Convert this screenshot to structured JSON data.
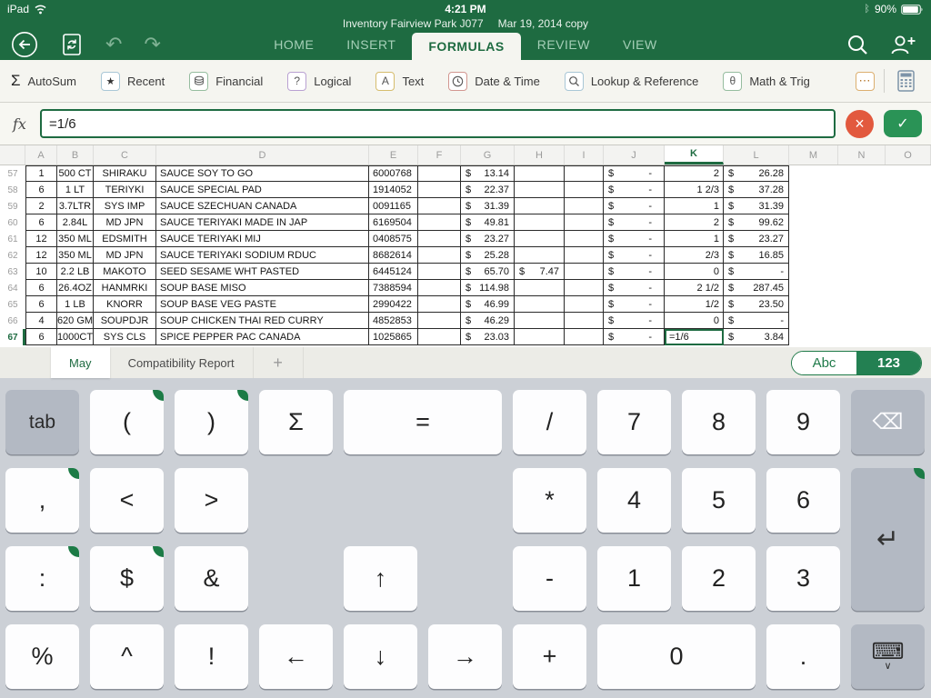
{
  "status_bar": {
    "device": "iPad",
    "time": "4:21 PM",
    "bluetooth_glyph": "ᛒ",
    "battery_pct": "90%"
  },
  "doc_title": {
    "line1": "Inventory Fairview Park  J077",
    "line2": "Mar 19, 2014 copy"
  },
  "nav": {
    "undo_glyph": "↶",
    "redo_glyph": "↷",
    "tabs": [
      {
        "label": "HOME"
      },
      {
        "label": "INSERT"
      },
      {
        "label": "FORMULAS",
        "active": true
      },
      {
        "label": "REVIEW"
      },
      {
        "label": "VIEW"
      }
    ]
  },
  "ribbon": {
    "sigma_glyph": "Σ",
    "items": [
      {
        "label": "AutoSum"
      },
      {
        "label": "Recent"
      },
      {
        "label": "Financial"
      },
      {
        "label": "Logical"
      },
      {
        "label": "Text"
      },
      {
        "label": "Date & Time"
      },
      {
        "label": "Lookup & Reference"
      },
      {
        "label": "Math & Trig"
      }
    ],
    "icon_glyphs": {
      "star": "★",
      "question": "?",
      "letter_a": "A",
      "theta": "θ",
      "more": "⋯"
    }
  },
  "formula_bar": {
    "fx_label": "fx",
    "value": "=1/6",
    "cancel_glyph": "×",
    "confirm_glyph": "✓"
  },
  "grid": {
    "col_headers": [
      "A",
      "B",
      "C",
      "D",
      "E",
      "F",
      "G",
      "H",
      "I",
      "J",
      "K",
      "L",
      "M",
      "N",
      "O"
    ],
    "selected_column": "K",
    "selected_cell": "K67",
    "rows": [
      {
        "n": "57",
        "a": "1",
        "b": "500 CT",
        "c": "SHIRAKU",
        "d": "SAUCE SOY TO GO",
        "e": "6000768",
        "g1": "$",
        "g": "13.14",
        "j1": "$",
        "j": "-",
        "k": "2",
        "l1": "$",
        "l": "26.28"
      },
      {
        "n": "58",
        "a": "6",
        "b": "1 LT",
        "c": "TERIYKI",
        "d": "SAUCE SPECIAL PAD",
        "e": "1914052",
        "g1": "$",
        "g": "22.37",
        "j1": "$",
        "j": "-",
        "k": "1 2/3",
        "l1": "$",
        "l": "37.28"
      },
      {
        "n": "59",
        "a": "2",
        "b": "3.7LTR",
        "c": "SYS IMP",
        "d": "SAUCE SZECHUAN CANADA",
        "e": "0091165",
        "g1": "$",
        "g": "31.39",
        "j1": "$",
        "j": "-",
        "k": "1",
        "l1": "$",
        "l": "31.39"
      },
      {
        "n": "60",
        "a": "6",
        "b": "2.84L",
        "c": "MD JPN",
        "d": "SAUCE TERIYAKI MADE IN JAP",
        "e": "6169504",
        "g1": "$",
        "g": "49.81",
        "j1": "$",
        "j": "-",
        "k": "2",
        "l1": "$",
        "l": "99.62"
      },
      {
        "n": "61",
        "a": "12",
        "b": "350 ML",
        "c": "EDSMITH",
        "d": "SAUCE TERIYAKI MIJ",
        "e": "0408575",
        "g1": "$",
        "g": "23.27",
        "j1": "$",
        "j": "-",
        "k": "1",
        "l1": "$",
        "l": "23.27"
      },
      {
        "n": "62",
        "a": "12",
        "b": "350 ML",
        "c": "MD JPN",
        "d": "SAUCE TERIYAKI SODIUM RDUC",
        "e": "8682614",
        "g1": "$",
        "g": "25.28",
        "j1": "$",
        "j": "-",
        "k": "2/3",
        "l1": "$",
        "l": "16.85"
      },
      {
        "n": "63",
        "a": "10",
        "b": "2.2 LB",
        "c": "MAKOTO",
        "d": "SEED SESAME WHT PASTED",
        "e": "6445124",
        "g1": "$",
        "g": "65.70",
        "h1": "$",
        "h": "7.47",
        "j1": "$",
        "j": "-",
        "k": "0",
        "l1": "$",
        "l": "-"
      },
      {
        "n": "64",
        "a": "6",
        "b": "26.4OZ",
        "c": "HANMRKI",
        "d": "SOUP BASE MISO",
        "e": "7388594",
        "g1": "$",
        "g": "114.98",
        "j1": "$",
        "j": "-",
        "k": "2 1/2",
        "l1": "$",
        "l": "287.45"
      },
      {
        "n": "65",
        "a": "6",
        "b": "1 LB",
        "c": "KNORR",
        "d": "SOUP BASE VEG PASTE",
        "e": "2990422",
        "g1": "$",
        "g": "46.99",
        "j1": "$",
        "j": "-",
        "k": "1/2",
        "l1": "$",
        "l": "23.50"
      },
      {
        "n": "66",
        "a": "4",
        "b": "620 GM",
        "c": "SOUPDJR",
        "d": "SOUP CHICKEN THAI RED CURRY",
        "e": "4852853",
        "g1": "$",
        "g": "46.29",
        "j1": "$",
        "j": "-",
        "k": "0",
        "l1": "$",
        "l": "-"
      },
      {
        "n": "67",
        "a": "6",
        "b": "1000CT",
        "c": "SYS CLS",
        "d": "SPICE PEPPER PAC CANADA",
        "e": "1025865",
        "g1": "$",
        "g": "23.03",
        "j1": "$",
        "j": "-",
        "k": "=1/6",
        "l1": "$",
        "l": "3.84"
      }
    ]
  },
  "sheet_bar": {
    "active_tab": "May",
    "report_tab": "Compatibility Report",
    "add_glyph": "+",
    "mode_abc": "Abc",
    "mode_123": "123"
  },
  "keyboard": {
    "keys": [
      "tab",
      "(",
      ")",
      "Σ",
      "=",
      "/",
      "7",
      "8",
      "9",
      "⌫",
      ",",
      "<",
      ">",
      "*",
      "4",
      "5",
      "6",
      "↵",
      ":",
      "$",
      "&",
      "↑",
      "-",
      "1",
      "2",
      "3",
      "%",
      "^",
      "!",
      "←",
      "↓",
      "→",
      "+",
      "0",
      ".",
      "⌨"
    ]
  }
}
